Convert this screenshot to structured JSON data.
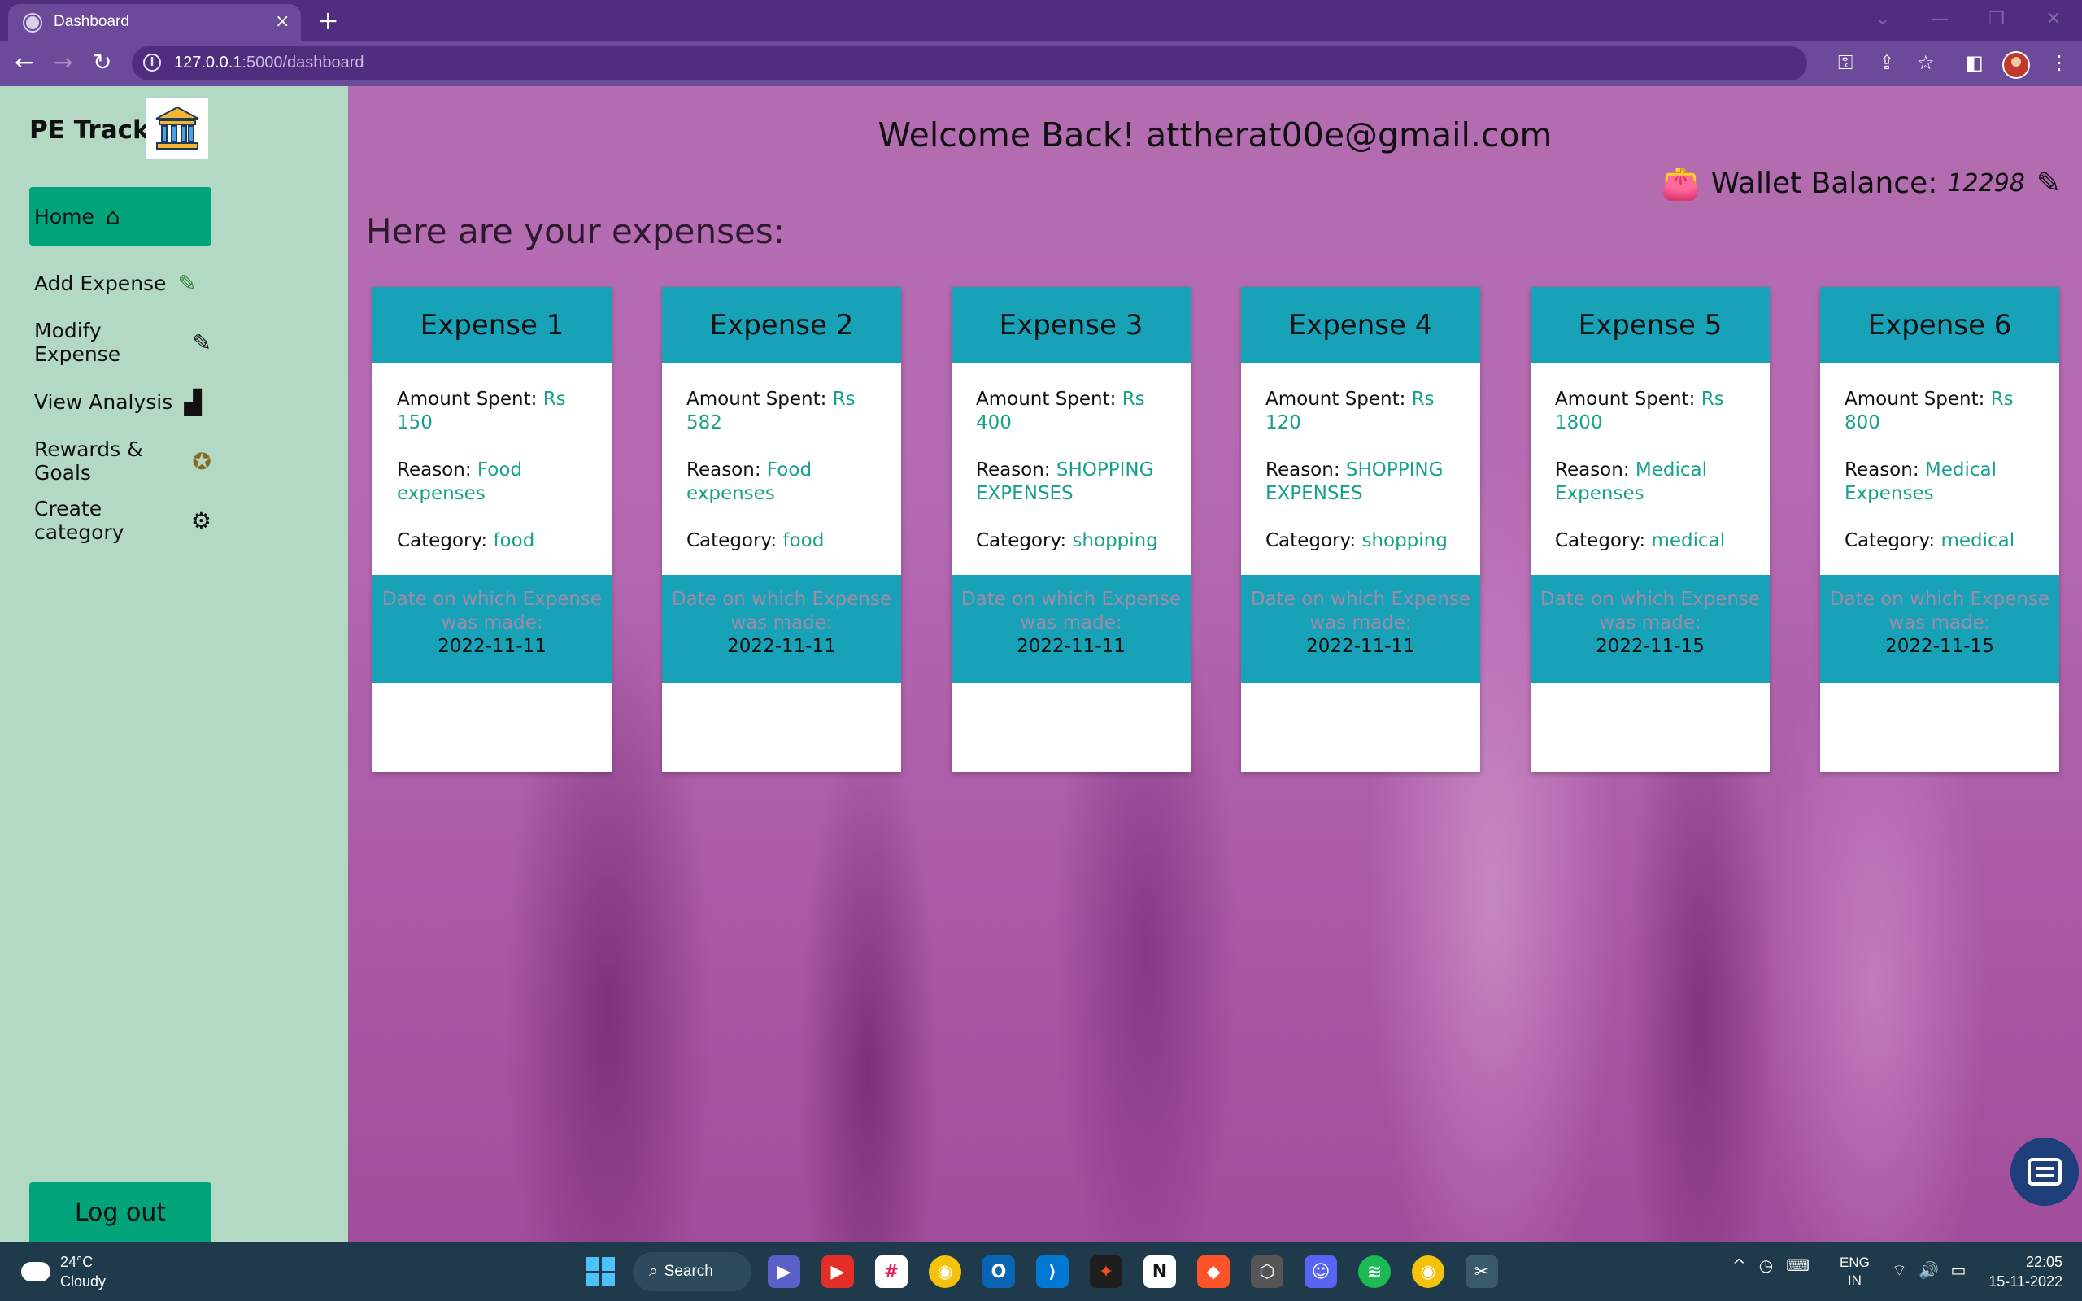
{
  "browser": {
    "tab_title": "Dashboard",
    "tab_close": "×",
    "new_tab": "+",
    "url_host": "127.0.0.1",
    "url_path": ":5000/dashboard"
  },
  "sidebar": {
    "brand": "PE Tracker",
    "items": [
      {
        "label": "Home",
        "icon": "home-icon",
        "glyph": "🏠"
      },
      {
        "label": "Add Expense",
        "icon": "add-expense-icon",
        "glyph": "🖊"
      },
      {
        "label": "Modify Expense",
        "icon": "edit-icon",
        "glyph": "✎"
      },
      {
        "label": "View Analysis",
        "icon": "chart-icon",
        "glyph": "📊"
      },
      {
        "label": "Rewards & Goals",
        "icon": "award-icon",
        "glyph": "🏅"
      },
      {
        "label": "Create category",
        "icon": "category-icon",
        "glyph": "⚙"
      }
    ],
    "logout": "Log out"
  },
  "header": {
    "welcome": "Welcome Back! attherat00e@gmail.com",
    "wallet_label": "Wallet Balance:",
    "wallet_value": "12298",
    "subheading": "Here are your expenses:"
  },
  "labels": {
    "amount": "Amount Spent:",
    "reason": "Reason:",
    "category": "Category:",
    "date_label": "Date on which Expense was made:"
  },
  "expenses": [
    {
      "title": "Expense 1",
      "amount": "Rs 150",
      "reason": "Food expenses",
      "category": "food",
      "date": "2022-11-11"
    },
    {
      "title": "Expense 2",
      "amount": "Rs 582",
      "reason": "Food expenses",
      "category": "food",
      "date": "2022-11-11"
    },
    {
      "title": "Expense 3",
      "amount": "Rs 400",
      "reason": "SHOPPING EXPENSES",
      "category": "shopping",
      "date": "2022-11-11"
    },
    {
      "title": "Expense 4",
      "amount": "Rs 120",
      "reason": "SHOPPING EXPENSES",
      "category": "shopping",
      "date": "2022-11-11"
    },
    {
      "title": "Expense 5",
      "amount": "Rs 1800",
      "reason": "Medical Expenses",
      "category": "medical",
      "date": "2022-11-15"
    },
    {
      "title": "Expense 6",
      "amount": "Rs 800",
      "reason": "Medical Expenses",
      "category": "medical",
      "date": "2022-11-15"
    }
  ],
  "taskbar": {
    "temp": "24°C",
    "weather": "Cloudy",
    "search": "Search",
    "lang_1": "ENG",
    "lang_2": "IN",
    "time": "22:05",
    "date": "15-11-2022"
  },
  "colors": {
    "sidebar_bg": "#b3d9c5",
    "accent_green": "#00a37a",
    "card_teal": "#17a2b8",
    "value_green": "#17a08a"
  }
}
